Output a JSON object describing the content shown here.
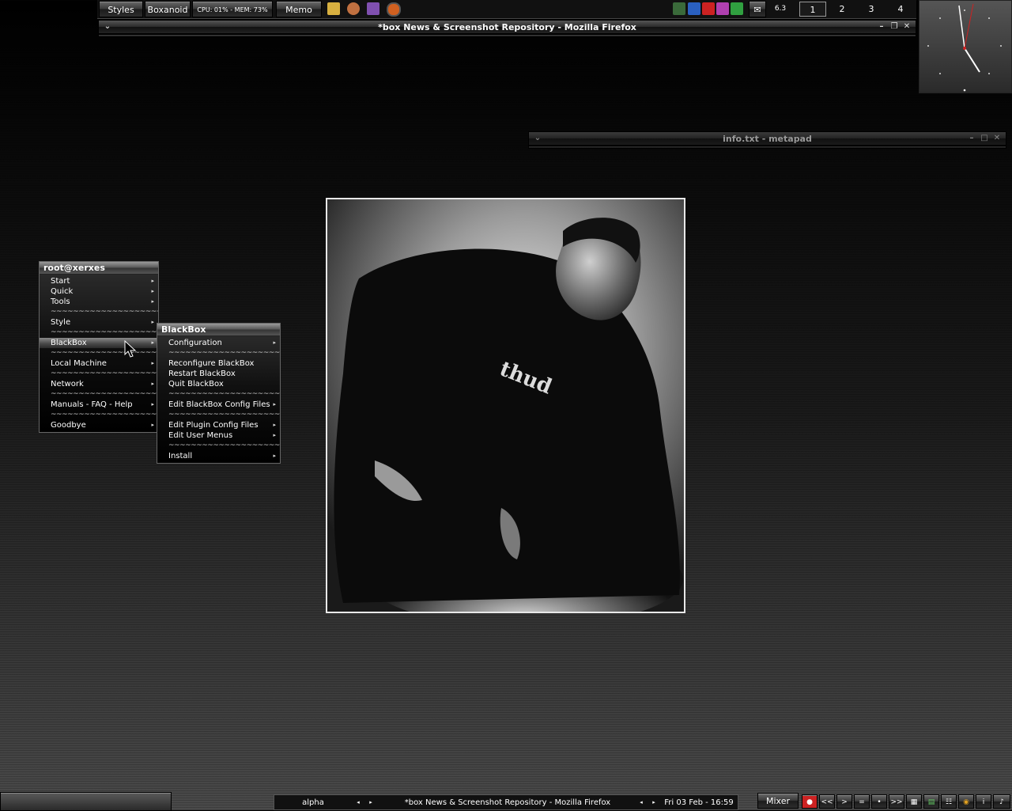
{
  "toolbar": {
    "styles_label": "Styles",
    "boxanoid_label": "Boxanoid",
    "cpu_mem": "CPU: 01% - MEM: 73%",
    "memo_label": "Memo",
    "temp": "6.3",
    "workspaces": [
      "1",
      "2",
      "3",
      "4"
    ]
  },
  "windows": {
    "firefox_title": "*box News & Screenshot Repository - Mozilla Firefox",
    "metapad_title": "info.txt - metapad"
  },
  "root_menu": {
    "title": "root@xerxes",
    "items": [
      {
        "label": "Start",
        "submenu": true
      },
      {
        "label": "Quick",
        "submenu": true
      },
      {
        "label": "Tools",
        "submenu": true
      },
      {
        "label": "~~~~~~~~~~~~~~~~~~~~~~~~",
        "sep": true
      },
      {
        "label": "Style",
        "submenu": true
      },
      {
        "label": "~~~~~~~~~~~~~~~~~~~~~~~~",
        "sep": true
      },
      {
        "label": "BlackBox",
        "submenu": true,
        "active": true
      },
      {
        "label": "~~~~~~~~~~~~~~~~~~~~~~~~",
        "sep": true
      },
      {
        "label": "Local Machine",
        "submenu": true
      },
      {
        "label": "~~~~~~~~~~~~~~~~~~~~~~~~",
        "sep": true
      },
      {
        "label": "Network",
        "submenu": true
      },
      {
        "label": "~~~~~~~~~~~~~~~~~~~~~~~~",
        "sep": true
      },
      {
        "label": "Manuals - FAQ - Help",
        "submenu": true
      },
      {
        "label": "~~~~~~~~~~~~~~~~~~~~~~~~",
        "sep": true
      },
      {
        "label": "Goodbye",
        "submenu": true
      }
    ]
  },
  "blackbox_menu": {
    "title": "BlackBox",
    "items": [
      {
        "label": "Configuration",
        "submenu": true
      },
      {
        "label": "~~~~~~~~~~~~~~~~~~~~~~~~",
        "sep": true
      },
      {
        "label": "Reconfigure BlackBox",
        "submenu": false
      },
      {
        "label": "Restart BlackBox",
        "submenu": false
      },
      {
        "label": "Quit BlackBox",
        "submenu": false
      },
      {
        "label": "~~~~~~~~~~~~~~~~~~~~~~~~",
        "sep": true
      },
      {
        "label": "Edit BlackBox Config Files",
        "submenu": true
      },
      {
        "label": "~~~~~~~~~~~~~~~~~~~~~~~~",
        "sep": true
      },
      {
        "label": "Edit Plugin Config Files",
        "submenu": true
      },
      {
        "label": "Edit User Menus",
        "submenu": true
      },
      {
        "label": "~~~~~~~~~~~~~~~~~~~~~~~~",
        "sep": true
      },
      {
        "label": "Install",
        "submenu": true
      }
    ]
  },
  "wallpaper": {
    "shirt_text": "thud"
  },
  "bottombar": {
    "workspace_name": "alpha",
    "task_title": "*box News & Screenshot Repository - Mozilla Firefox",
    "clock": "Fri 03 Feb - 16:59",
    "mixer_label": "Mixer",
    "media_buttons": [
      "<<",
      ">",
      "=",
      "•",
      ">>"
    ]
  },
  "colors": {
    "accent_red": "#cc2222",
    "frame_white": "#e8e8e8"
  }
}
